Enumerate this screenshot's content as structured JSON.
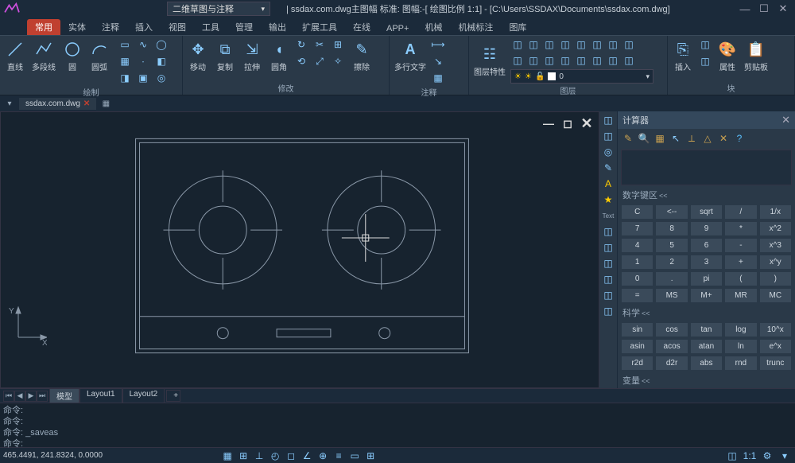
{
  "title": {
    "drawing_mode": "二维草图与注释",
    "text": "| ssdax.com.dwg主图幅  标准: 图幅:-[ 绘图比例 1:1] - [C:\\Users\\SSDAX\\Documents\\ssdax.com.dwg]"
  },
  "tabs": {
    "items": [
      "常用",
      "实体",
      "注释",
      "插入",
      "视图",
      "工具",
      "管理",
      "输出",
      "扩展工具",
      "在线",
      "APP+",
      "机械",
      "机械标注",
      "图库"
    ],
    "active_index": 0
  },
  "ribbon": {
    "draw": {
      "label": "绘制",
      "btns": [
        "直线",
        "多段线",
        "圆",
        "圆弧"
      ]
    },
    "modify": {
      "label": "修改",
      "btns": [
        "移动",
        "复制",
        "拉伸",
        "圆角",
        "擦除"
      ]
    },
    "annot": {
      "label": "注释",
      "btn": "多行文字"
    },
    "layer": {
      "label": "图层",
      "btn": "图层特性",
      "current": "0"
    },
    "block": {
      "label": "块",
      "btns": [
        "插入",
        "属性",
        "剪贴板"
      ]
    }
  },
  "filetab": {
    "name": "ssdax.com.dwg"
  },
  "layouts": {
    "items": [
      "模型",
      "Layout1",
      "Layout2"
    ],
    "active": 0
  },
  "cmd": {
    "prompt": "命令:",
    "saveas": "_saveas"
  },
  "status": {
    "coords": "465.4491, 241.8324, 0.0000"
  },
  "calc": {
    "title": "计算器",
    "sections": {
      "num": "数字键区",
      "sci": "科学",
      "var": "变量"
    },
    "numpad": [
      [
        "C",
        "<--",
        "sqrt",
        "/",
        "1/x"
      ],
      [
        "7",
        "8",
        "9",
        "*",
        "x^2"
      ],
      [
        "4",
        "5",
        "6",
        "-",
        "x^3"
      ],
      [
        "1",
        "2",
        "3",
        "+",
        "x^y"
      ],
      [
        "0",
        ".",
        "pi",
        "(",
        ")"
      ],
      [
        "=",
        "MS",
        "M+",
        "MR",
        "MC"
      ]
    ],
    "scipad": [
      [
        "sin",
        "cos",
        "tan",
        "log",
        "10^x"
      ],
      [
        "asin",
        "acos",
        "atan",
        "ln",
        "e^x"
      ],
      [
        "r2d",
        "d2r",
        "abs",
        "rnd",
        "trunc"
      ]
    ]
  },
  "ucs": {
    "x": "X",
    "y": "Y"
  }
}
